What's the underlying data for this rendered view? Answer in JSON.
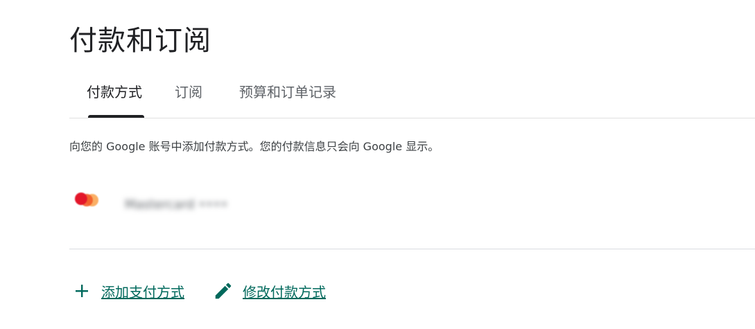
{
  "page": {
    "title": "付款和订阅"
  },
  "tabs": [
    {
      "label": "付款方式",
      "active": true
    },
    {
      "label": "订阅",
      "active": false
    },
    {
      "label": "预算和订单记录",
      "active": false
    }
  ],
  "description": "向您的 Google 账号中添加付款方式。您的付款信息只会向 Google 显示。",
  "payment_method": {
    "card_brand_icon": "mastercard-icon",
    "card_text_blurred": "Mastercard ••••"
  },
  "actions": {
    "add_label": "添加支付方式",
    "add_icon": "plus-icon",
    "edit_label": "修改付款方式",
    "edit_icon": "pencil-icon"
  },
  "colors": {
    "accent": "#00695c",
    "text_primary": "#202124",
    "text_secondary": "#5f6368",
    "divider": "#e0e0e0"
  }
}
